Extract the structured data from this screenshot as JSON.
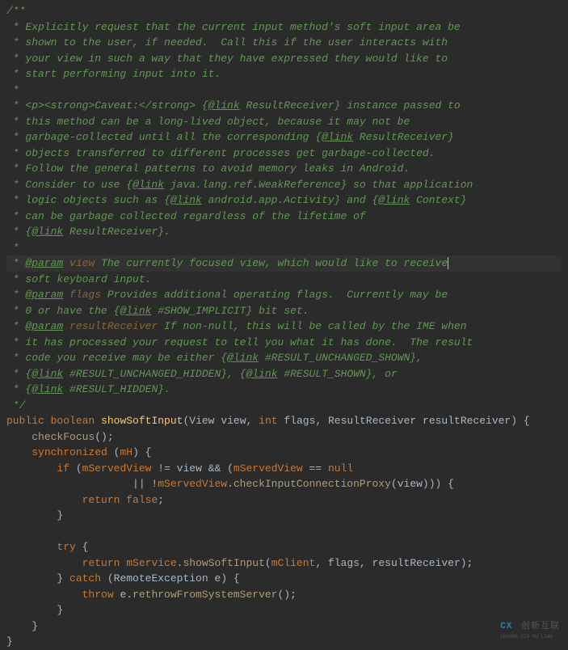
{
  "doc": {
    "open": "/**",
    "l1": " * Explicitly request that the current input method's soft input area be",
    "l2": " * shown to the user, if needed.  Call this if the user interacts with",
    "l3": " * your view in such a way that they have expressed they would like to",
    "l4": " * start performing input into it.",
    "star": " *",
    "l6a": " * <p><strong>Caveat:</strong> {",
    "link": "@link",
    "l6b": " ResultReceiver} instance passed to",
    "l7": " * this method can be a long-lived object, because it may not be",
    "l8a": " * garbage-collected until all the corresponding {",
    "l8b": " ResultReceiver}",
    "l9": " * objects transferred to different processes get garbage-collected.",
    "l10": " * Follow the general patterns to avoid memory leaks in Android.",
    "l11a": " * Consider to use {",
    "l11b": " java.lang.ref.WeakReference} so that application",
    "l12a": " * logic objects such as {",
    "l12b": " android.app.Activity} and {",
    "l12c": " Context}",
    "l13": " * can be garbage collected regardless of the lifetime of",
    "l14a": " * {",
    "l14b": " ResultReceiver}.",
    "param": "@param",
    "p1name": "view",
    "p1a": " The currently focused view, which would like to receive",
    "p1b": " * soft keyboard input.",
    "p2name": "flags",
    "p2a": " Provides additional operating flags.  Currently may be",
    "p2b_a": " * 0 or have the {",
    "p2b_b": " #SHOW_IMPLICIT} bit set.",
    "p3name": "resultReceiver",
    "p3a": " If non-null, this will be called by the IME when",
    "p3b": " * it has processed your request to tell you what it has done.  The result",
    "p3c_a": " * code you receive may be either {",
    "p3c_b": " #RESULT_UNCHANGED_SHOWN},",
    "p3d_a": " * {",
    "p3d_b": " #RESULT_UNCHANGED_HIDDEN}, {",
    "p3d_c": " #RESULT_SHOWN}, or",
    "p3e_a": " * {",
    "p3e_b": " #RESULT_HIDDEN}.",
    "close": " */"
  },
  "code": {
    "kw_public": "public",
    "kw_boolean": "boolean",
    "kw_int": "int",
    "kw_synchronized": "synchronized",
    "kw_if": "if",
    "kw_null": "null",
    "kw_return": "return",
    "kw_false": "false",
    "kw_try": "try",
    "kw_catch": "catch",
    "kw_throw": "throw",
    "method_name": "showSoftInput",
    "type_view": "View",
    "arg_view": "view",
    "arg_flags": "flags",
    "type_rr": "ResultReceiver",
    "arg_rr": "resultReceiver",
    "call_checkFocus": "checkFocus",
    "field_mH": "mH",
    "field_mServedView": "mServedView",
    "call_checkICP": "checkInputConnectionProxy",
    "field_mService": "mService",
    "call_showSoftInput": "showSoftInput",
    "field_mClient": "mClient",
    "type_re": "RemoteException",
    "arg_e": "e",
    "call_rethrow": "rethrowFromSystemServer"
  },
  "watermark": {
    "icon": "CX",
    "text": "创新互联",
    "sub": "CHUANG XIN HU LIAN"
  }
}
